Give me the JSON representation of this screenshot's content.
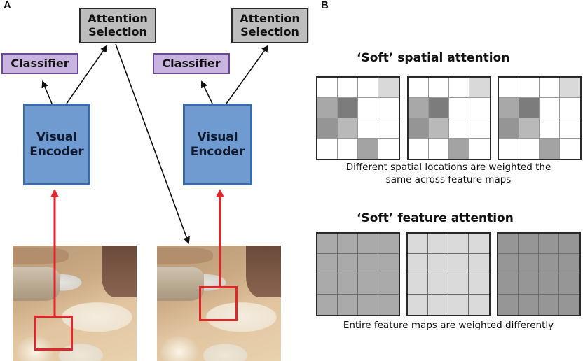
{
  "panel_a": {
    "label": "A",
    "left_pipeline": {
      "attention_box": {
        "line1": "Attention",
        "line2": "Selection"
      },
      "classifier_box": "Classifier",
      "encoder_box": {
        "line1": "Visual",
        "line2": "Encoder"
      },
      "photo": "dinner-table-photo",
      "glimpse_focus": "lower-left table region"
    },
    "right_pipeline": {
      "attention_box": {
        "line1": "Attention",
        "line2": "Selection"
      },
      "classifier_box": "Classifier",
      "encoder_box": {
        "line1": "Visual",
        "line2": "Encoder"
      },
      "photo": "dinner-table-photo",
      "glimpse_focus": "plate and spoon region"
    },
    "colors": {
      "attention_fill": "#bdbdbd",
      "classifier_fill": "#c9b3e0",
      "classifier_border": "#6a4a96",
      "encoder_fill": "#6f9bd1",
      "encoder_border": "#3e6aa8",
      "glimpse_red": "#e0262b"
    }
  },
  "panel_b": {
    "label": "B",
    "spatial": {
      "title": "‘Soft’ spatial attention",
      "caption_line1": "Different spatial locations are weighted the",
      "caption_line2": "same across feature maps",
      "maps": [
        {
          "cells": [
            [
              "#ffffff",
              "#ffffff",
              "#ffffff",
              "#d9d9d9"
            ],
            [
              "#a8a8a8",
              "#7c7c7c",
              "#ffffff",
              "#ffffff"
            ],
            [
              "#959595",
              "#b9b9b9",
              "#ffffff",
              "#ffffff"
            ],
            [
              "#ffffff",
              "#ffffff",
              "#a3a3a3",
              "#ffffff"
            ]
          ]
        },
        {
          "cells": [
            [
              "#ffffff",
              "#ffffff",
              "#ffffff",
              "#d9d9d9"
            ],
            [
              "#a8a8a8",
              "#7c7c7c",
              "#ffffff",
              "#ffffff"
            ],
            [
              "#959595",
              "#b9b9b9",
              "#ffffff",
              "#ffffff"
            ],
            [
              "#ffffff",
              "#ffffff",
              "#a3a3a3",
              "#ffffff"
            ]
          ]
        },
        {
          "cells": [
            [
              "#ffffff",
              "#ffffff",
              "#ffffff",
              "#d9d9d9"
            ],
            [
              "#a8a8a8",
              "#7c7c7c",
              "#ffffff",
              "#ffffff"
            ],
            [
              "#959595",
              "#b9b9b9",
              "#ffffff",
              "#ffffff"
            ],
            [
              "#ffffff",
              "#ffffff",
              "#a3a3a3",
              "#ffffff"
            ]
          ]
        }
      ]
    },
    "feature": {
      "title": "‘Soft’ feature attention",
      "caption": "Entire feature maps are weighted differently",
      "map_fills": [
        "#aaaaaa",
        "#dadada",
        "#969696"
      ]
    }
  }
}
